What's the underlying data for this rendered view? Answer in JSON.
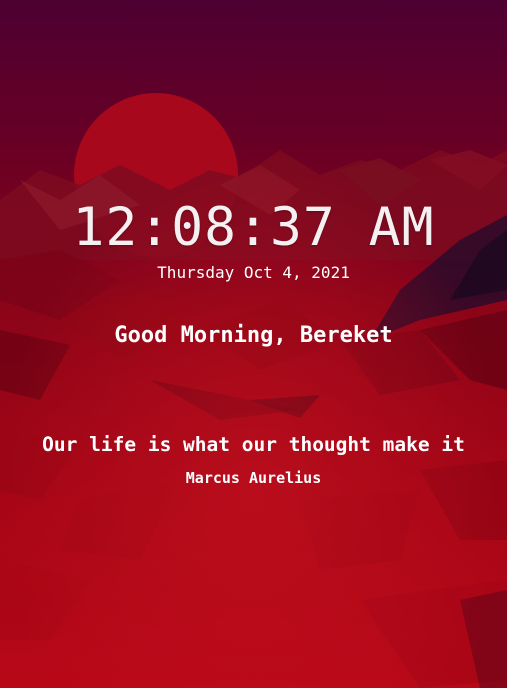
{
  "clock": {
    "time": "12:08:37 AM",
    "date": "Thursday Oct 4, 2021"
  },
  "greeting": {
    "text": "Good Morning, Bereket"
  },
  "quote": {
    "text": "Our life is what our thought make it",
    "author": "Marcus Aurelius"
  },
  "theme": {
    "background_top": "#4f0030",
    "background_mid": "#8a0018",
    "background_bottom": "#b50617",
    "sun_color": "#b00a1e",
    "text_color": "#ffffff"
  }
}
